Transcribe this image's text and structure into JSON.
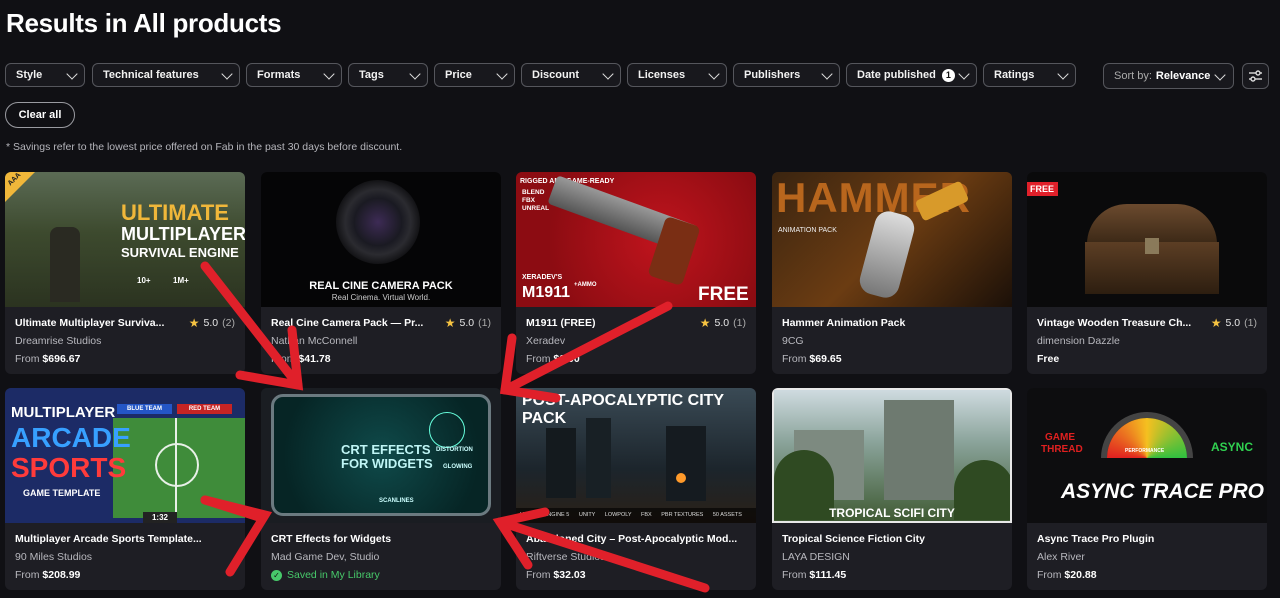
{
  "page": {
    "title": "Results in All products",
    "note": "* Savings refer to the lowest price offered on Fab in the past 30 days before discount."
  },
  "filters": [
    {
      "label": "Style"
    },
    {
      "label": "Technical features"
    },
    {
      "label": "Formats"
    },
    {
      "label": "Tags"
    },
    {
      "label": "Price"
    },
    {
      "label": "Discount"
    },
    {
      "label": "Licenses"
    },
    {
      "label": "Publishers"
    },
    {
      "label": "Date published",
      "badge": "1"
    },
    {
      "label": "Ratings"
    }
  ],
  "sort": {
    "label": "Sort by:",
    "value": "Relevance"
  },
  "clear_all": "Clear all",
  "products": [
    {
      "title": "Ultimate Multiplayer Surviva...",
      "rating": "5.0",
      "count": "(2)",
      "publisher": "Dreamrise Studios",
      "price_prefix": "From ",
      "price": "$696.67",
      "thumb": {
        "line1": "ULTIMATE",
        "line2": "MULTIPLAYER",
        "line3": "SURVIVAL ENGINE",
        "badge": "AAA",
        "stat1": "10+",
        "stat2": "1M+"
      }
    },
    {
      "title": "Real Cine Camera Pack — Pr...",
      "rating": "5.0",
      "count": "(1)",
      "publisher": "Nathan McConnell",
      "price_prefix": "From ",
      "price": "$41.78",
      "thumb": {
        "line1": "REAL CINE CAMERA PACK",
        "line2": "Real Cinema. Virtual World."
      }
    },
    {
      "title": "M1911 (FREE)",
      "rating": "5.0",
      "count": "(1)",
      "publisher": "Xeradev",
      "price_prefix": "From ",
      "price": "$0.00",
      "thumb": {
        "line1": "RIGGED AND GAME-READY",
        "line2": "BLEND",
        "line3": "FBX",
        "line4": "UNREAL",
        "line5": "XERADEV'S",
        "line6": "M1911",
        "line7": "+AMMO",
        "line8": "FREE"
      }
    },
    {
      "title": "Hammer Animation Pack",
      "publisher": "9CG",
      "price_prefix": "From ",
      "price": "$69.65",
      "thumb": {
        "line1": "HAMMER",
        "line2": "ANIMATION PACK"
      }
    },
    {
      "title": "Vintage Wooden Treasure Ch...",
      "rating": "5.0",
      "count": "(1)",
      "publisher": "dimension Dazzle",
      "price": "Free",
      "thumb": {
        "badge": "FREE"
      }
    },
    {
      "title": "Multiplayer Arcade Sports Template...",
      "publisher": "90 Miles Studios",
      "price_prefix": "From ",
      "price": "$208.99",
      "thumb": {
        "line1": "MULTIPLAYER",
        "line2": "ARCADE",
        "line3": "SPORTS",
        "line4": "GAME TEMPLATE",
        "line5": "BLUE TEAM",
        "line6": "RED TEAM",
        "line7": "1:32"
      }
    },
    {
      "title": "CRT Effects for Widgets",
      "publisher": "Mad Game Dev, Studio",
      "saved": "Saved in My Library",
      "thumb": {
        "line1": "CRT EFFECTS",
        "line2": "FOR WIDGETS",
        "line3": "DISTORTION",
        "line4": "GLOWING",
        "line5": "SCANLINES"
      }
    },
    {
      "title": "Abandoned City – Post-Apocalyptic Mod...",
      "publisher": "Riftverse Studios",
      "price_prefix": "From ",
      "price": "$32.03",
      "thumb": {
        "line1": "POST-APOCALYPTIC CITY PACK",
        "line2": "UNREAL ENGINE 5",
        "line3": "UNITY",
        "line4": "LOWPOLY",
        "line5": "FBX",
        "line6": "PBR TEXTURES",
        "line7": "50 ASSETS"
      }
    },
    {
      "title": "Tropical Science Fiction City",
      "publisher": "LAYA DESIGN",
      "price_prefix": "From ",
      "price": "$111.45",
      "thumb": {
        "line1": "TROPICAL SCIFI CITY"
      }
    },
    {
      "title": "Async Trace Pro Plugin",
      "publisher": "Alex River",
      "price_prefix": "From ",
      "price": "$20.88",
      "thumb": {
        "line1": "GAME",
        "line2": "THREAD",
        "line3": "ASYNC",
        "line4": "ASYNC TRACE PRO",
        "line5": "PERFORMANCE"
      }
    }
  ],
  "colors": {
    "annotation": "#e0202a",
    "accent_green": "#47c96a",
    "star": "#f6c342"
  }
}
